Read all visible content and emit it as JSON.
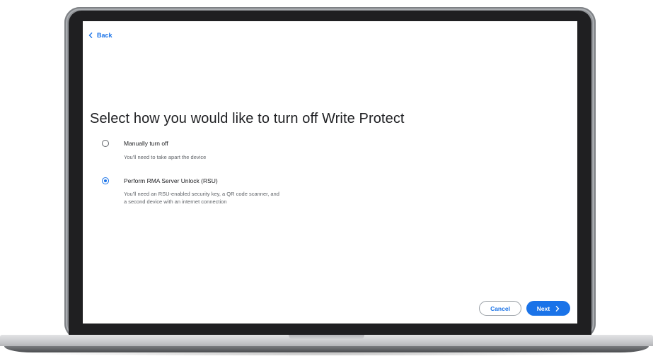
{
  "nav": {
    "back_label": "Back",
    "back_icon": "chevron-left-icon"
  },
  "page": {
    "title": "Select how you would like to turn off Write Protect"
  },
  "options": [
    {
      "label": "Manually turn off",
      "description_lines": [
        "You'll need to take apart the device"
      ],
      "selected": false
    },
    {
      "label": "Perform RMA Server Unlock (RSU)",
      "description_lines": [
        "You'll need an RSU-enabled security key, a QR code scanner, and",
        "a second device with an internet connection"
      ],
      "selected": true
    }
  ],
  "footer": {
    "cancel_label": "Cancel",
    "next_label": "Next",
    "next_icon": "chevron-right-icon"
  },
  "colors": {
    "accent": "#1a73e8",
    "title_text": "#202124",
    "secondary_text": "#5f6368",
    "laptop_frame": "#95989c",
    "bezel": "#1f1f21"
  }
}
